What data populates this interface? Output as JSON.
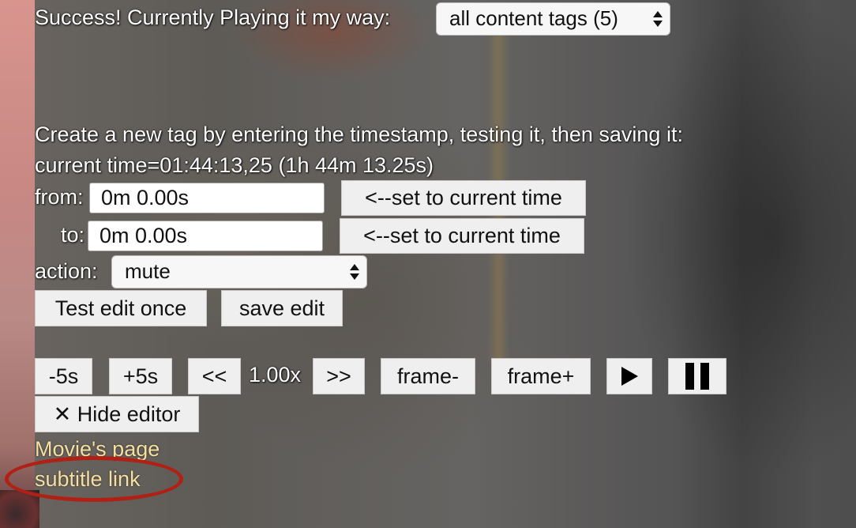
{
  "status": {
    "text": "Success! Currently Playing it my way:",
    "tags_select_value": "all content tags (5)"
  },
  "editor": {
    "instructions": "Create a new tag by entering the timestamp, testing it, then saving it:",
    "current_time": "current time=01:44:13,25 (1h 44m 13.25s)",
    "from_label": "from:",
    "from_value": "0m 0.00s",
    "to_label": "to:",
    "to_value": "0m 0.00s",
    "set_current_label": "<--set to current time",
    "action_label": "action:",
    "action_value": "mute",
    "test_button": "Test edit once",
    "save_button": "save edit"
  },
  "controls": {
    "minus5": "-5s",
    "plus5": "+5s",
    "slower": "<<",
    "speed": "1.00x",
    "faster": ">>",
    "frame_back": "frame-",
    "frame_fwd": "frame+",
    "play_icon": "play-icon",
    "pause_icon": "pause-icon",
    "hide_editor": "✕ Hide editor"
  },
  "links": {
    "movie_page": "Movie's page",
    "subtitle": "subtitle link"
  },
  "colors": {
    "link": "#f6dfa0",
    "annotation_circle": "#b02014",
    "button_bg": "#efefef"
  }
}
